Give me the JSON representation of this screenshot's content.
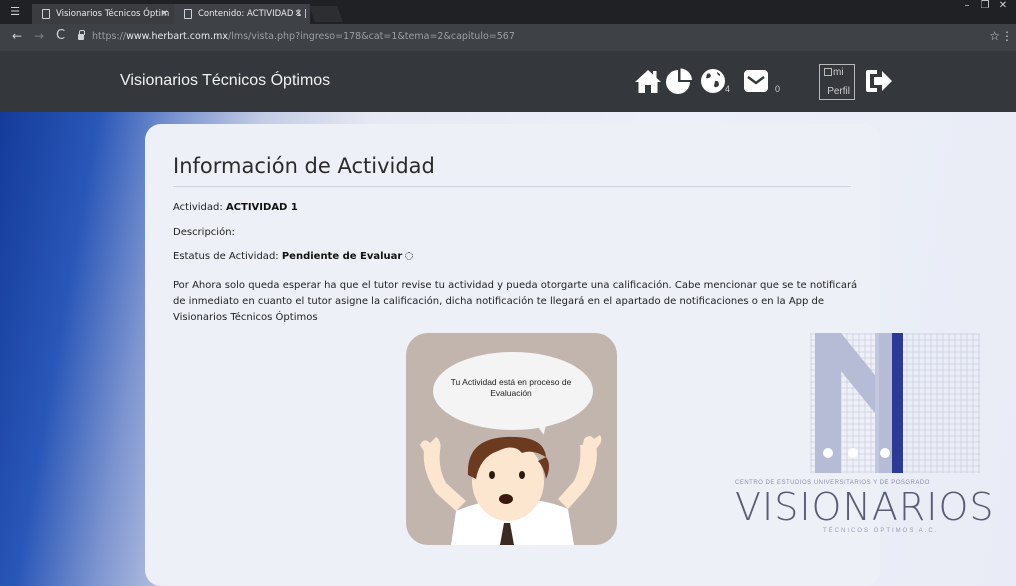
{
  "browser": {
    "tabs": [
      {
        "title": "Visionarios Técnicos Óptim",
        "active": false
      },
      {
        "title": "Contenido: ACTIVIDAD 1 |",
        "active": true
      }
    ],
    "url_scheme": "https://",
    "url_host": "www.herbart.com.mx",
    "url_path": "/lms/vista.php?ingreso=178&cat=1&tema=2&capitulo=567"
  },
  "header": {
    "brand": "Visionarios Técnicos Óptimos",
    "notifications_count": "4",
    "messages_count": "0",
    "profile_alt_line1": "mi",
    "profile_alt_line2": "Perfil"
  },
  "activity": {
    "heading": "Información de Actividad",
    "activity_label": "Actividad: ",
    "activity_value": "ACTIVIDAD 1",
    "description_label": "Descripción:",
    "status_label": "Estatus de Actividad: ",
    "status_value": "Pendiente de Evaluar",
    "message": "Por Ahora solo queda esperar ha que el tutor revise tu actividad y pueda otorgarte una calificación. Cabe mencionar que se te notificará de inmediato en cuanto el tutor asigne la calificación, dicha notificación te llegará en el apartado de notificaciones o en la App de Visionarios Técnicos Óptimos"
  },
  "illustration": {
    "bubble_text": "Tu Actividad está en proceso de Evaluación"
  },
  "logo": {
    "small_text": "CENTRO DE ESTUDIOS UNIVERSITARIOS Y DE POSGRADO",
    "big_text": "VISIONARIOS",
    "sub_text": "TÉCNICOS ÓPTIMOS A.C."
  },
  "colors": {
    "header_bg": "#34373b",
    "logo_blue": "#2b3a96",
    "logo_lavender": "#b7bcd6"
  }
}
